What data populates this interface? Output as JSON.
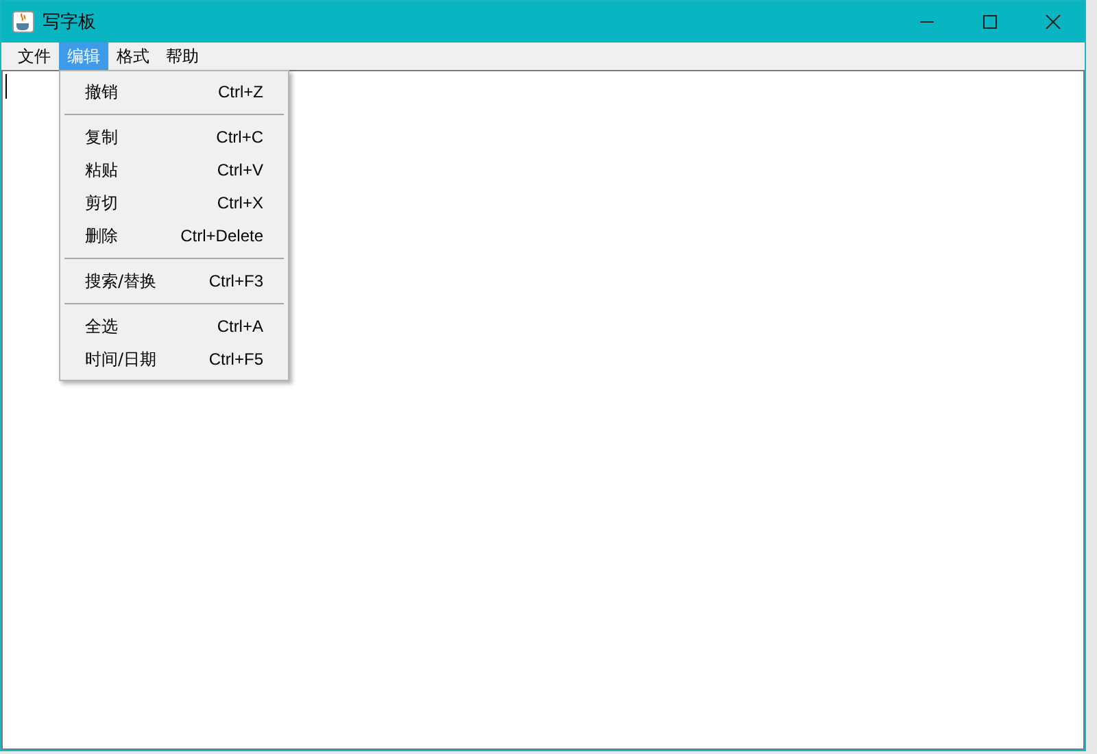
{
  "window": {
    "title": "写字板"
  },
  "menu_bar": [
    {
      "label": "文件",
      "selected": false
    },
    {
      "label": "编辑",
      "selected": true
    },
    {
      "label": "格式",
      "selected": false
    },
    {
      "label": "帮助",
      "selected": false
    }
  ],
  "dropdown": [
    {
      "kind": "item",
      "label": "撤销",
      "shortcut": "Ctrl+Z"
    },
    {
      "kind": "separator"
    },
    {
      "kind": "item",
      "label": "复制",
      "shortcut": "Ctrl+C"
    },
    {
      "kind": "item",
      "label": "粘贴",
      "shortcut": "Ctrl+V"
    },
    {
      "kind": "item",
      "label": "剪切",
      "shortcut": "Ctrl+X"
    },
    {
      "kind": "item",
      "label": "删除",
      "shortcut": "Ctrl+Delete"
    },
    {
      "kind": "separator"
    },
    {
      "kind": "item",
      "label": "搜索/替换",
      "shortcut": "Ctrl+F3"
    },
    {
      "kind": "separator"
    },
    {
      "kind": "item",
      "label": "全选",
      "shortcut": "Ctrl+A"
    },
    {
      "kind": "item",
      "label": "时间/日期",
      "shortcut": "Ctrl+F5"
    }
  ]
}
